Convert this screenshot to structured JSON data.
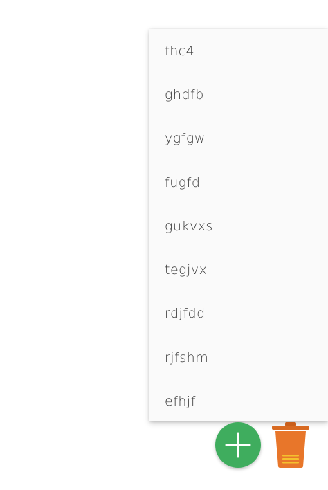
{
  "menu": {
    "items": [
      {
        "label": "fhc4"
      },
      {
        "label": "ghdfb"
      },
      {
        "label": "ygfgw"
      },
      {
        "label": "fugfd"
      },
      {
        "label": "gukvxs"
      },
      {
        "label": "tegjvx"
      },
      {
        "label": "rdjfdd"
      },
      {
        "label": "rjfshm"
      },
      {
        "label": "efhjf"
      }
    ]
  },
  "icons": {
    "add": "plus-icon",
    "delete": "trash-icon"
  },
  "colors": {
    "add_button": "#3fad5e",
    "delete_button": "#e8762a",
    "delete_accent": "#f5c02e"
  }
}
